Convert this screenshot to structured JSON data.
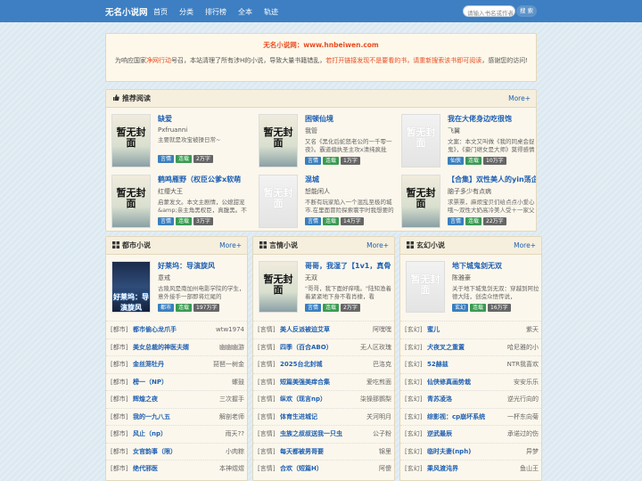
{
  "site": {
    "logo": "无名小说网",
    "nav": [
      "首页",
      "分类",
      "排行榜",
      "全本",
      "轨迹"
    ],
    "search_placeholder": "请输入书名或作者",
    "search_button": "搜 索"
  },
  "notice": {
    "title": "无名小说网：www.hnbeiwen.com",
    "text_a": "为响应国家",
    "text_b": "净网行动",
    "text_c": "号召，本站清理了所有涉H的小说，导致大量书籍错乱，",
    "text_d": "若打开链接发现不是要看的书，请重新搜索该书即可阅读",
    "text_e": "，感谢您的访问!"
  },
  "recommend": {
    "title": "推荐阅读",
    "more": "More+",
    "books": [
      {
        "title": "缺爱",
        "author": "Pxfruanni",
        "desc": "主要就是攻宝被操日常~",
        "tags": [
          "言情",
          "连载",
          "2万字"
        ],
        "cover": "暂无封面",
        "style": "img1"
      },
      {
        "title": "困顿仙境",
        "author": "我管",
        "desc": "又名《黑化后蛇怒老公的一千零一夜》。霸道偏执圣主攻x清纯疯批",
        "tags": [
          "言情",
          "连载",
          "1万字"
        ],
        "cover": "暂无封面",
        "style": "img1"
      },
      {
        "title": "我在大佬身边吃很饱",
        "author": "飞翼",
        "desc": "文案：本文又叫做《我的同桌会捉鬼》，《豪门继女是大师》莫得感情",
        "tags": [
          "仙侠",
          "连载",
          "10万字"
        ],
        "cover": "暂无封面",
        "style": "gen"
      },
      {
        "title": "鹤鸣雁野（权臣公爹x软萌",
        "author": "红缨大王",
        "desc": "启蒙发文。本文主剧情，公媳甜宠&amp;亲主角黑权臣，真腹黑。不是",
        "tags": [
          "言情",
          "连载",
          "3万字"
        ],
        "cover": "暂无封面",
        "style": "img1"
      },
      {
        "title": "混城",
        "author": "恕能闲人",
        "desc": "不断有玩家陷入一个混乱至极的城市.在里面冒险探索寰宇时我想要的",
        "tags": [
          "言情",
          "连载",
          "14万字"
        ],
        "cover": "暂无封面",
        "style": "gen"
      },
      {
        "title": "【合集】双性美人的yin荡企",
        "author": "脑子多少有点病",
        "desc": "求票票，麻烦宝贝们给点点小爱心哦～双性大奶高冷美人受＋一家父",
        "tags": [
          "言情",
          "连载",
          "22万字"
        ],
        "cover": "暂无封面",
        "style": "img1"
      }
    ]
  },
  "categories": [
    {
      "title": "都市小说",
      "more": "More+",
      "feat": {
        "title": "好莱坞：导演旋风",
        "author": "意戒",
        "desc": "古陵风是南加州电影学院的学生，意外接手一部即将烂尾的",
        "tags": [
          "都市",
          "连载",
          "197万字"
        ],
        "cover": "好莱坞：导演旋风",
        "style": "anime"
      },
      "rows": [
        [
          "[都市]",
          "都市偷心龙爪手",
          "wtw1974"
        ],
        [
          "[都市]",
          "美女总裁的神医夫婿",
          "幽幽幽游"
        ],
        [
          "[都市]",
          "金丝笼牡丹",
          "琵琶一树金"
        ],
        [
          "[都市]",
          "榜一（NP）",
          "螺鼓"
        ],
        [
          "[都市]",
          "辉煌之夜",
          "三次握手"
        ],
        [
          "[都市]",
          "我的一九八五",
          "解剖老师"
        ],
        [
          "[都市]",
          "风止（np）",
          "雨天??"
        ],
        [
          "[都市]",
          "女官韵事（限）",
          "小肉粽"
        ],
        [
          "[都市]",
          "绝代邪医",
          "本神煜煜"
        ]
      ]
    },
    {
      "title": "言情小说",
      "more": "More+",
      "feat": {
        "title": "哥哥，我湿了【1v1，真骨",
        "author": "无双",
        "desc": "\"哥哥，我下面好痒哦。\"陆知渔着着紧紧地下身不看肖棣，看",
        "tags": [
          "言情",
          "连载",
          "2万字"
        ],
        "cover": "暂无封面",
        "style": "img1"
      },
      "rows": [
        [
          "[言情]",
          "美人反派被迫艾草",
          "阿嘿嘿"
        ],
        [
          "[言情]",
          "四季（百合ABO）",
          "无人区玫瑰"
        ],
        [
          "[言情]",
          "2025台北封城",
          "巴洛克"
        ],
        [
          "[言情]",
          "短篇美强美痒合集",
          "爱吃煎面"
        ],
        [
          "[言情]",
          "纵欢（现言np）",
          "柒操那鹦梨"
        ],
        [
          "[言情]",
          "体育生进城记",
          "关河明月"
        ],
        [
          "[言情]",
          "虫族之叔叔送我一只虫",
          "公子粉"
        ],
        [
          "[言情]",
          "每天都被男哥要",
          "锦里"
        ],
        [
          "[言情]",
          "合欢（短篇H）",
          "阿傻"
        ]
      ]
    },
    {
      "title": "玄幻小说",
      "more": "More+",
      "feat": {
        "title": "地下城鬼剑无双",
        "author": "陈雅豪",
        "desc": "关于地下城鬼剑无双：穿越到阿拉德大陆，创造众悟传说，",
        "tags": [
          "玄幻",
          "连载",
          "16万字"
        ],
        "cover": "暂无封面",
        "style": "gen"
      },
      "rows": [
        [
          "[玄幻]",
          "蜜儿",
          "紫天"
        ],
        [
          "[玄幻]",
          "犬夜叉之重置",
          "哈尼雅的小"
        ],
        [
          "[玄幻]",
          "52赫兹",
          "NTR我喜欢"
        ],
        [
          "[玄幻]",
          "仙侠修真画势栽",
          "安安乐乐"
        ],
        [
          "[玄幻]",
          "青苏凌洛",
          "逆光行向的"
        ],
        [
          "[玄幻]",
          "综影视：cp崩坏系统",
          "一杯东向菊"
        ],
        [
          "[玄幻]",
          "逆武最辰",
          "承诺过的伤"
        ],
        [
          "[玄幻]",
          "临时夫妻(nph)",
          "异梦"
        ],
        [
          "[玄幻]",
          "乘风渡沌界",
          "鱼山王"
        ]
      ]
    }
  ]
}
